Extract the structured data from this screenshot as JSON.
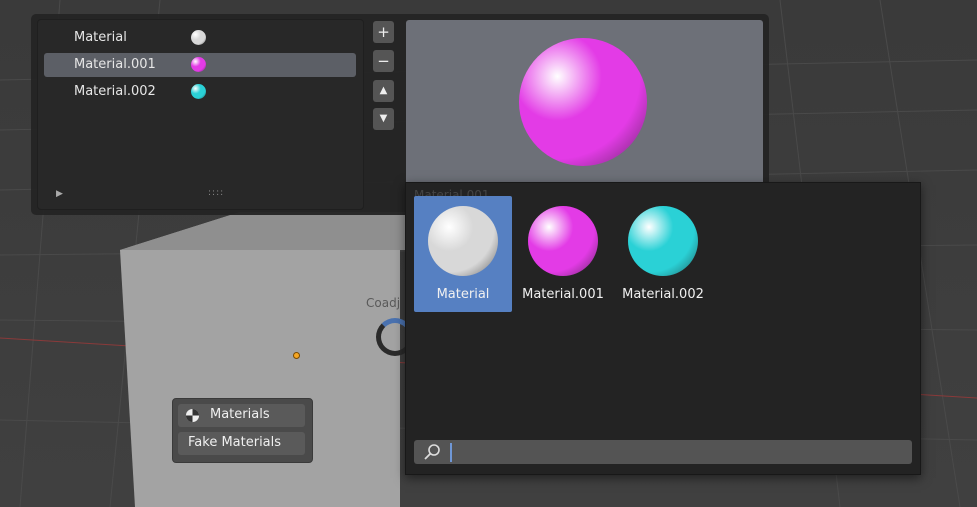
{
  "material_slots": {
    "items": [
      {
        "label": "Material",
        "color": "#d8d8d8",
        "active": false
      },
      {
        "label": "Material.001",
        "color": "#e33be6",
        "active": true
      },
      {
        "label": "Material.002",
        "color": "#2ad1d6",
        "active": false
      }
    ],
    "add_glyph": "+",
    "remove_glyph": "−",
    "up_glyph": "▲",
    "down_glyph": "▼",
    "expand_glyph": "▶",
    "grip_glyph": "::::"
  },
  "preview": {
    "color": "#e33be6"
  },
  "viewport": {
    "ghost_label": "Coadj"
  },
  "menu": {
    "items": [
      {
        "label": "Materials",
        "icon": "material-sphere-icon"
      },
      {
        "label": "Fake Materials",
        "icon": null
      }
    ]
  },
  "browser": {
    "ghost_header": "Material.001",
    "tiles": [
      {
        "label": "Material",
        "color": "#d8d8d8",
        "selected": true
      },
      {
        "label": "Material.001",
        "color": "#e33be6",
        "selected": false
      },
      {
        "label": "Material.002",
        "color": "#2ad1d6",
        "selected": false
      }
    ],
    "search_value": ""
  }
}
